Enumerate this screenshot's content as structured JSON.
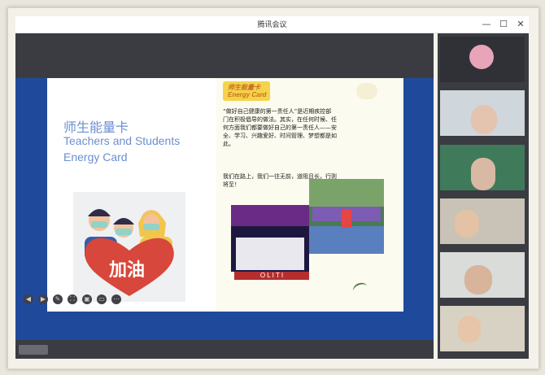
{
  "window": {
    "title": "腾讯会议",
    "minimize_glyph": "—",
    "maximize_glyph": "☐",
    "close_glyph": "✕"
  },
  "slide": {
    "heading_cn": "师生能量卡",
    "heading_en_line1": "Teachers and Students",
    "heading_en_line2": "Energy Card",
    "ribbon_line1": "师生能量卡",
    "ribbon_line2": "Energy Card",
    "paragraph1": "“做好自己健康的第一责任人”是近期疾控部门在积极倡导的做法。其实，在任何时候、任何方面我们都要做好自己的第一责任人——安全、学习、兴趣爱好、时间管理、梦想都是如此。",
    "paragraph2": "我们在路上，我们一往无前，道阻且长，行则将至！",
    "poster_text": "加油",
    "banner_letters": "O L I T I"
  },
  "toolbar": {
    "icons": [
      "prev-icon",
      "next-icon",
      "pen-icon",
      "screenshot-icon",
      "camera-icon",
      "chat-icon",
      "more-icon"
    ]
  },
  "colors": {
    "slide_border": "#1f4a9c",
    "heading": "#6b8fd0",
    "ribbon": "#c86f25",
    "meeting_bg": "#3a3c42"
  }
}
